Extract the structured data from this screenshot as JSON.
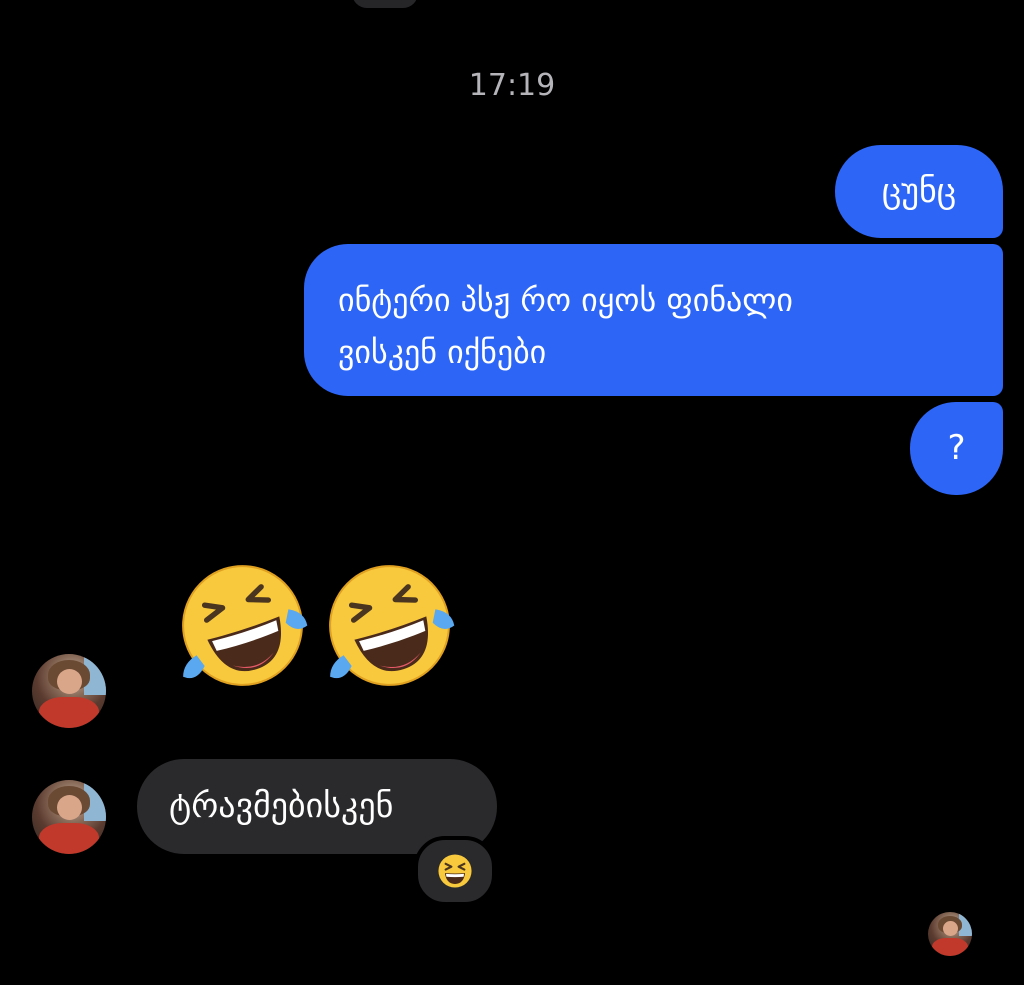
{
  "conversation": {
    "timestamp": "17:19",
    "messages": [
      {
        "direction": "outgoing",
        "text": "ცუნც"
      },
      {
        "direction": "outgoing",
        "lines": [
          "ინტერი პსჟ რო იყოს ფინალი",
          "ვისკენ იქნები"
        ]
      },
      {
        "direction": "outgoing",
        "text": "?"
      },
      {
        "direction": "incoming",
        "emoji": [
          "rolling-on-floor-laughing-emoji",
          "rolling-on-floor-laughing-emoji"
        ]
      },
      {
        "direction": "incoming",
        "text": "ტრავმებისკენ",
        "reaction": "grinning-squinting-face-emoji"
      }
    ],
    "read_receipt": "contact-avatar"
  },
  "colors": {
    "background": "#000000",
    "outgoing_bubble": "#2d66f6",
    "incoming_bubble": "#2a2a2d",
    "timestamp_text": "#b4b4b9"
  }
}
